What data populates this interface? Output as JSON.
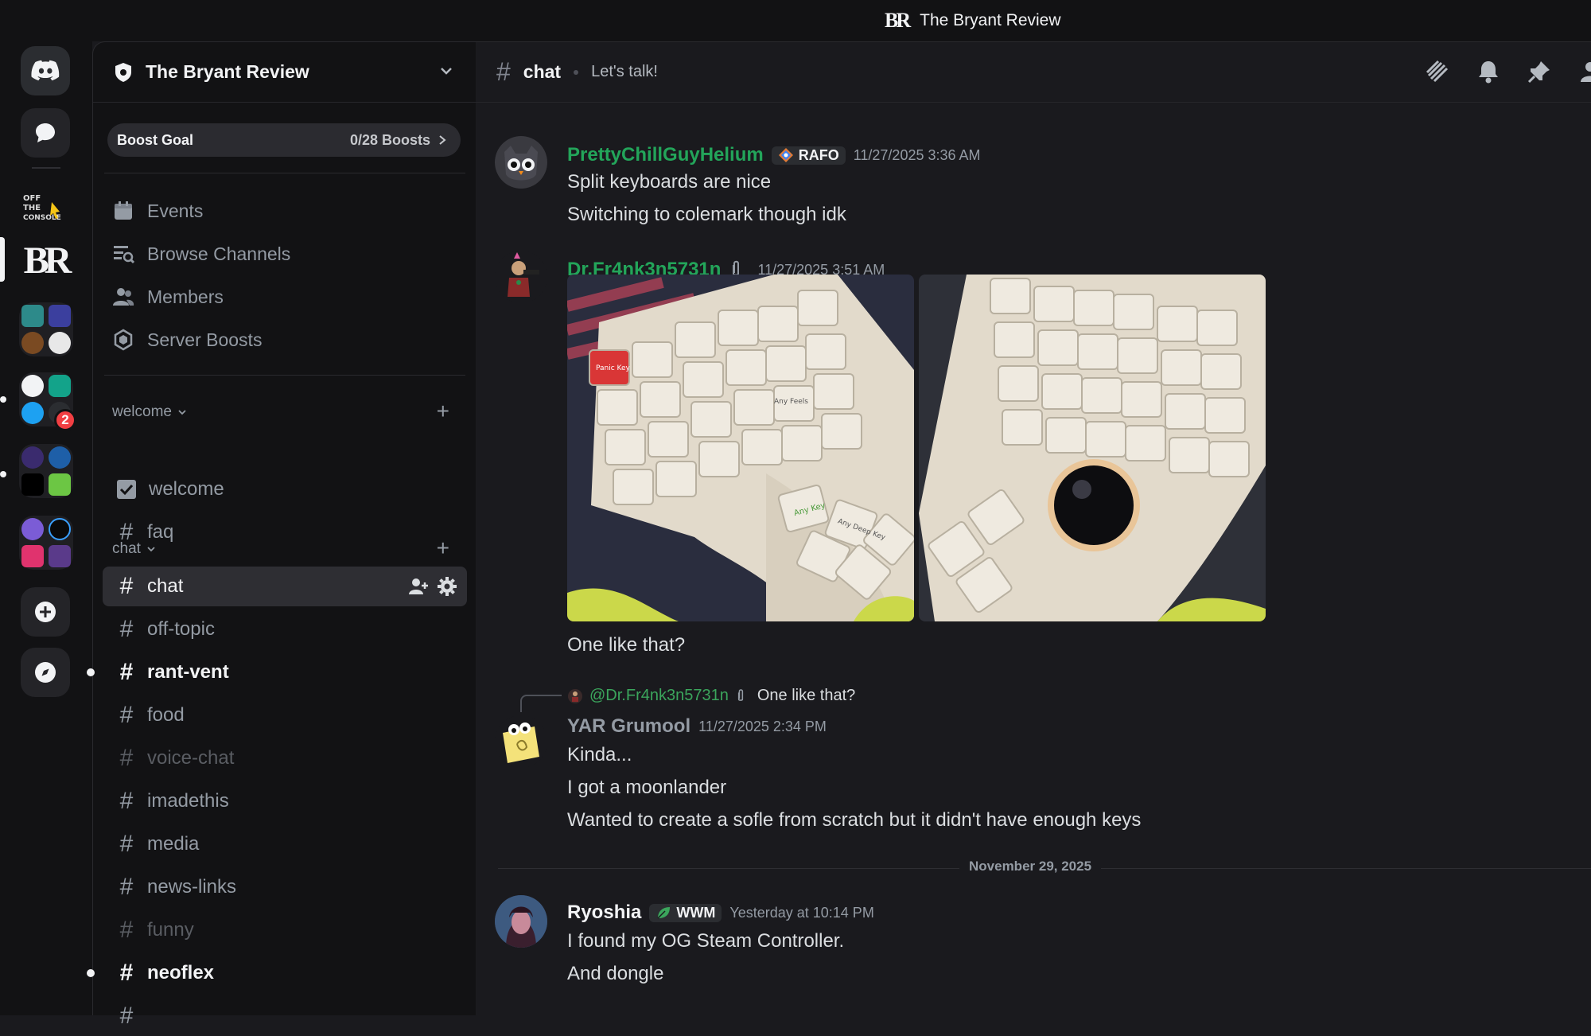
{
  "window": {
    "title": "The Bryant Review"
  },
  "colors": {
    "accent_green": "#23a55a",
    "mention_green": "#3ba55c",
    "unread_badge": "#f23f43"
  },
  "rail": {
    "badge_count": "2"
  },
  "server": {
    "name": "The Bryant Review",
    "boost_label": "Boost Goal",
    "boost_count": "0/28 Boosts"
  },
  "nav": [
    {
      "label": "Events",
      "icon": "calendar-icon"
    },
    {
      "label": "Browse Channels",
      "icon": "browse-channels-icon"
    },
    {
      "label": "Members",
      "icon": "members-icon"
    },
    {
      "label": "Server Boosts",
      "icon": "boost-gem-icon"
    }
  ],
  "categories": {
    "welcome": {
      "label": "welcome"
    },
    "chat": {
      "label": "chat"
    }
  },
  "channels": {
    "welcome": "welcome",
    "faq": "faq",
    "chat": "chat",
    "off_topic": "off-topic",
    "rant_vent": "rant-vent",
    "food": "food",
    "voice_chat": "voice-chat",
    "imadethis": "imadethis",
    "media": "media",
    "news_links": "news-links",
    "funny": "funny",
    "neoflex": "neoflex"
  },
  "header": {
    "channel": "chat",
    "topic": "Let's talk!"
  },
  "messages": {
    "m1": {
      "author": "PrettyChillGuyHelium",
      "tag": "RAFO",
      "time": "11/27/2025 3:36 AM",
      "lines": [
        "Split keyboards are nice",
        "Switching to colemark though idk"
      ]
    },
    "m2": {
      "author": "Dr.Fr4nk3n5731n",
      "time": "11/27/2025 3:51 AM",
      "image_keys": [
        "Panic Key",
        "Any Key",
        "Any Deep Key",
        "Any Feels"
      ],
      "caption": "One like that?"
    },
    "m3": {
      "reply_author": "@Dr.Fr4nk3n5731n",
      "reply_text": "One like that?",
      "author": "YAR Grumool",
      "time": "11/27/2025 2:34 PM",
      "lines": [
        "Kinda...",
        "I got a moonlander",
        "Wanted to create a sofle from scratch but it didn't have enough keys"
      ]
    },
    "date_divider": "November 29, 2025",
    "m4": {
      "author": "Ryoshia",
      "tag": "WWM",
      "time": "Yesterday at 10:14 PM",
      "lines": [
        "I found my OG Steam Controller.",
        "And dongle"
      ]
    }
  }
}
